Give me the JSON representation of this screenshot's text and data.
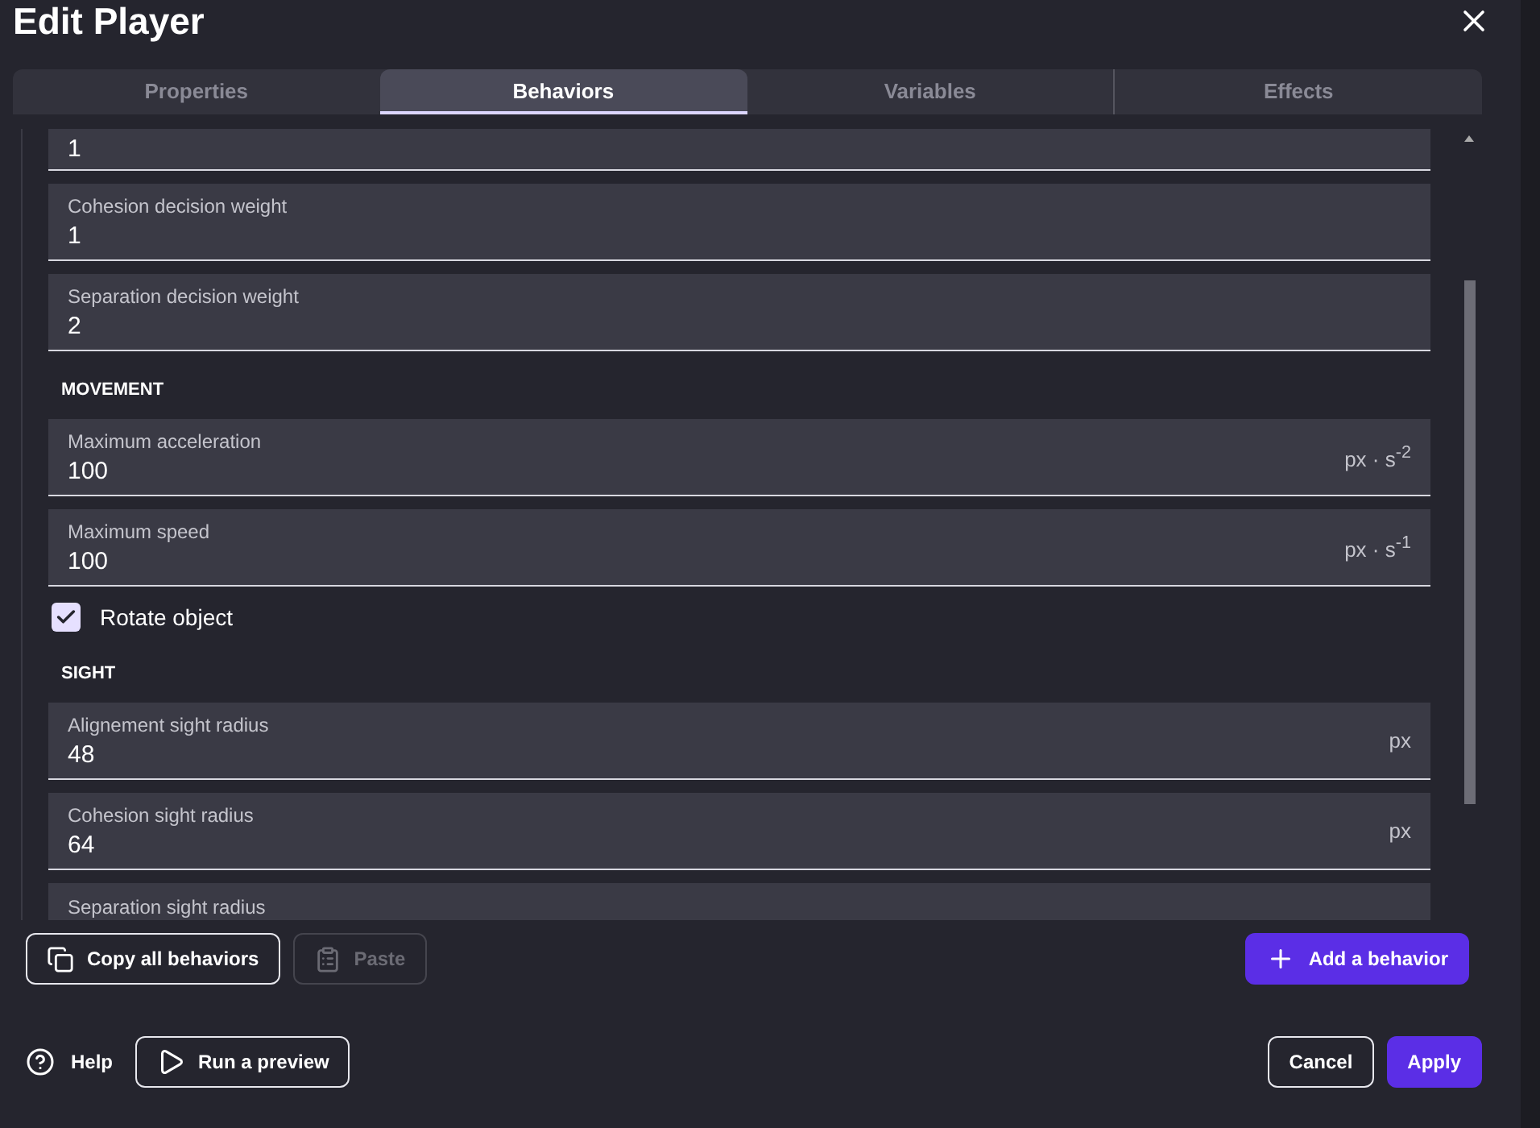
{
  "window": {
    "title": "Edit Player"
  },
  "tabs": [
    {
      "label": "Properties",
      "selected": false
    },
    {
      "label": "Behaviors",
      "selected": true
    },
    {
      "label": "Variables",
      "selected": false
    },
    {
      "label": "Effects",
      "selected": false
    }
  ],
  "items": [
    {
      "kind": "field",
      "value": "1"
    },
    {
      "kind": "field",
      "label": "Cohesion decision weight",
      "value": "1"
    },
    {
      "kind": "field",
      "label": "Separation decision weight",
      "value": "2"
    },
    {
      "kind": "section",
      "label": "MOVEMENT"
    },
    {
      "kind": "field",
      "label": "Maximum acceleration",
      "value": "100",
      "unit": "px · s$^{-2}$"
    },
    {
      "kind": "field",
      "label": "Maximum speed",
      "value": "100",
      "unit": "px · s$^{-1}$"
    },
    {
      "kind": "checkbox",
      "label": "Rotate object",
      "checked": true
    },
    {
      "kind": "section",
      "label": "SIGHT"
    },
    {
      "kind": "field",
      "label": "Alignement sight radius",
      "value": "48",
      "unit": "px"
    },
    {
      "kind": "field",
      "label": "Cohesion sight radius",
      "value": "64",
      "unit": "px"
    },
    {
      "kind": "field",
      "label": "Separation sight radius"
    }
  ],
  "actions": {
    "copy": "Copy all behaviors",
    "paste": "Paste",
    "paste_disabled": true,
    "add": "Add a behavior"
  },
  "footer": {
    "help": "Help",
    "preview": "Run a preview",
    "cancel": "Cancel",
    "apply": "Apply"
  }
}
